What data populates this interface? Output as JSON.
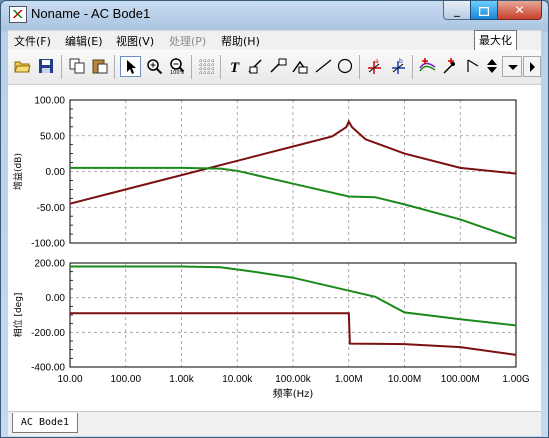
{
  "window": {
    "title": "Noname - AC Bode1",
    "maximize_tooltip": "最大化"
  },
  "menu": [
    {
      "label": "文件(F)",
      "enabled": true
    },
    {
      "label": "编辑(E)",
      "enabled": true
    },
    {
      "label": "视图(V)",
      "enabled": true
    },
    {
      "label": "处理(P)",
      "enabled": false
    },
    {
      "label": "帮助(H)",
      "enabled": true
    }
  ],
  "toolbar": {
    "icons": [
      "open-folder-icon",
      "save-disk-icon",
      "copy-icon",
      "paste-icon",
      "pointer-icon",
      "zoom-in-icon",
      "zoom-100-icon",
      "grid-icon",
      "text-icon",
      "label-icon",
      "label-icon-2",
      "label-icon-3",
      "line-icon",
      "circle-icon",
      "cursor-a-icon",
      "cursor-b-icon",
      "add-trace-icon",
      "select-trace-icon",
      "step-icon",
      "spin-up-icon",
      "spin-down-icon",
      "scroll-right-icon"
    ]
  },
  "tabs": [
    {
      "label": "AC Bode1",
      "active": true
    }
  ],
  "chart_data": [
    {
      "type": "line",
      "ylabel": "增益(dB)",
      "x_scale": "log",
      "xlim": [
        10,
        1000000000
      ],
      "ylim": [
        -100,
        100
      ],
      "yticks": [
        "100.00",
        "50.00",
        "0.00",
        "-50.00",
        "-100.00"
      ],
      "grid": true,
      "series": [
        {
          "color": "#7b1010",
          "x": [
            10,
            100,
            1000,
            10000,
            100000,
            500000,
            900000,
            1000000,
            1150000,
            2000000,
            10000000,
            100000000,
            1000000000
          ],
          "y": [
            -45,
            -25,
            -5,
            15,
            35,
            49,
            62,
            70,
            62,
            45,
            25,
            5,
            -3
          ]
        },
        {
          "color": "#1a8a1a",
          "x": [
            10,
            1000,
            5000,
            10000,
            100000,
            1000000,
            3000000,
            10000000,
            100000000,
            1000000000
          ],
          "y": [
            5,
            5,
            4,
            1,
            -17,
            -35,
            -36,
            -46,
            -67,
            -94
          ]
        }
      ]
    },
    {
      "type": "line",
      "ylabel": "相位 [deg]",
      "xlabel": "频率(Hz)",
      "x_scale": "log",
      "xlim": [
        10,
        1000000000
      ],
      "ylim": [
        -400,
        200
      ],
      "yticks": [
        "200.00",
        "0.00",
        "-200.00",
        "-400.00"
      ],
      "xticks": [
        "10.00",
        "100.00",
        "1.00k",
        "10.00k",
        "100.00k",
        "1.00M",
        "10.00M",
        "100.00M",
        "1.00G"
      ],
      "grid": true,
      "series": [
        {
          "color": "#1a8a1a",
          "x": [
            10,
            1000,
            5000,
            20000,
            100000,
            1000000,
            3000000,
            10000000,
            100000000,
            1000000000
          ],
          "y": [
            180,
            180,
            175,
            150,
            115,
            40,
            5,
            -85,
            -125,
            -160
          ]
        },
        {
          "color": "#7b1010",
          "x": [
            10,
            1000000,
            1000000,
            1050000,
            10000000,
            100000000,
            1000000000
          ],
          "y": [
            -90,
            -90,
            -90,
            -265,
            -268,
            -285,
            -330
          ]
        }
      ]
    }
  ]
}
